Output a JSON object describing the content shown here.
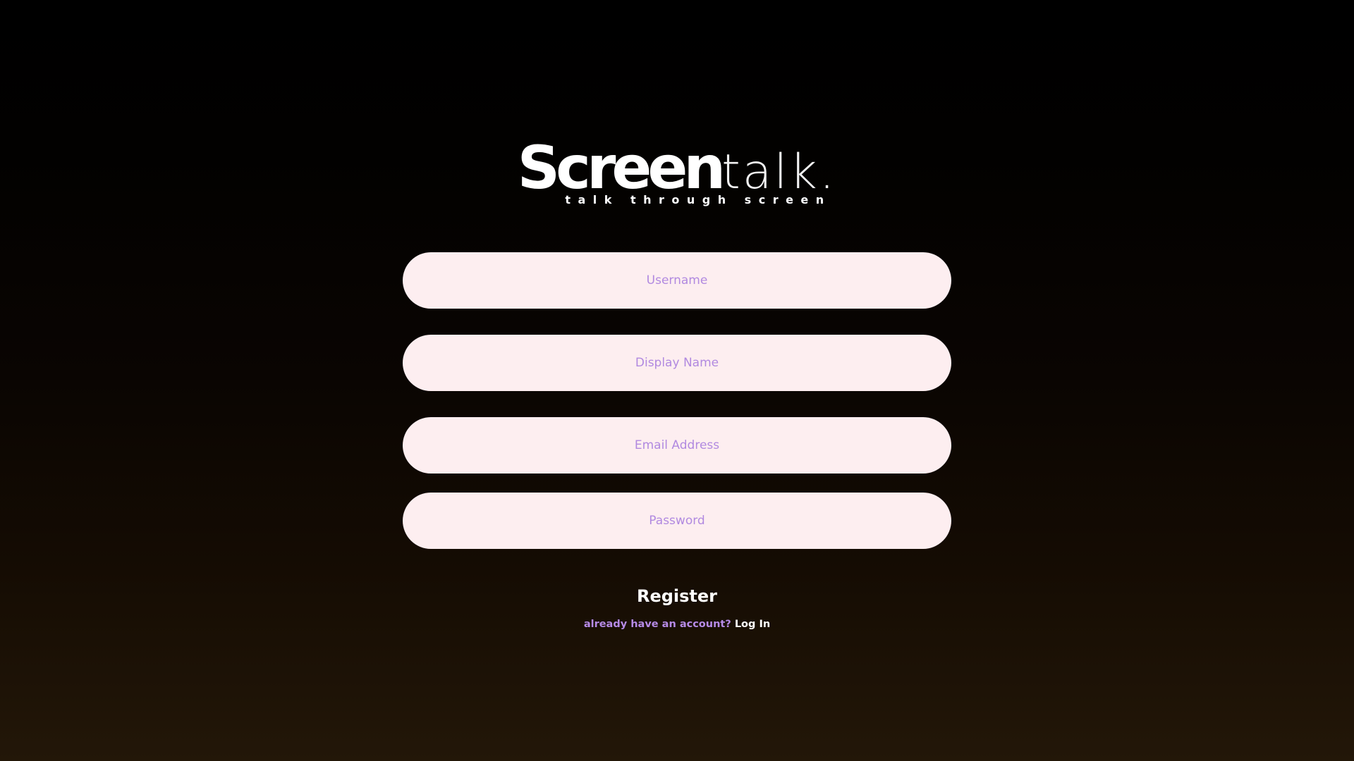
{
  "logo": {
    "brand_bold": "Screen",
    "brand_light": "talk.",
    "tagline": "talk through screen"
  },
  "form": {
    "username_placeholder": "Username",
    "display_name_placeholder": "Display Name",
    "email_placeholder": "Email Address",
    "password_placeholder": "Password",
    "register_label": "Register",
    "login_prompt": "already have an account?",
    "login_link_label": "Log In"
  },
  "colors": {
    "field_background": "#fdeef0",
    "placeholder": "#b189e0",
    "accent_purple": "#b58ae6",
    "text_white": "#ffffff"
  }
}
